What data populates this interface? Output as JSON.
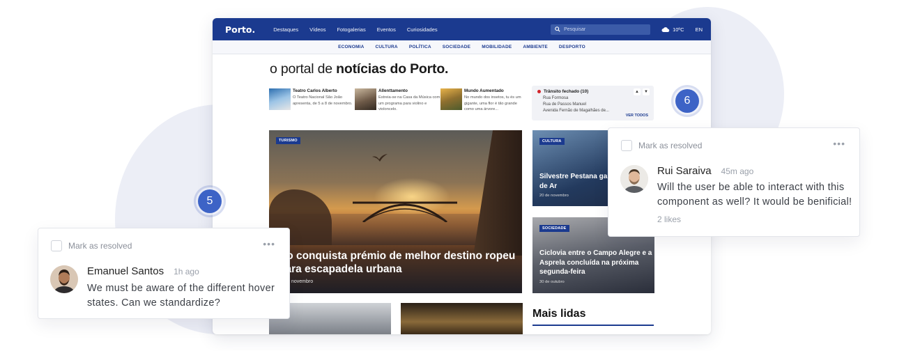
{
  "site": {
    "logo": "Porto.",
    "nav": [
      "Destaques",
      "Vídeos",
      "Fotogalerias",
      "Eventos",
      "Curiosidades"
    ],
    "search_placeholder": "Pesquisar",
    "temperature": "10ºC",
    "language": "EN",
    "categories": [
      "ECONOMIA",
      "CULTURA",
      "POLÍTICA",
      "SOCIEDADE",
      "MOBILIDADE",
      "AMBIENTE",
      "DESPORTO"
    ],
    "tagline_prefix": "o portal de ",
    "tagline_bold": "notícias do Porto."
  },
  "mini_articles": [
    {
      "title": "Teatro Carlos Alberto",
      "text": "O Teatro Nacional São João apresenta, de 5 a 8 de novembro."
    },
    {
      "title": "Allenttamento",
      "text": "Estreia-se na Casa da Música com um programa para violino e violoncelo."
    },
    {
      "title": "Mundo Aumentado",
      "text": "No mundo dos insetos, tu és um gigante, uma flor é tão grande como uma árvore..."
    }
  ],
  "traffic": {
    "title": "Trânsito fechado (10)",
    "items": [
      "Rua Formosa",
      "Rua de Passos Manuel",
      "Avenida Fernão de Magalhães de..."
    ],
    "see_all": "VER TODOS",
    "alert_color": "#d2232a"
  },
  "hero": {
    "badge": "TURISMO",
    "title": "rto conquista prémio de melhor destino ropeu para escapadela urbana",
    "date": "novembro"
  },
  "cards": [
    {
      "badge": "CULTURA",
      "title": "Silvestre Pestana ga com prémios de Ar",
      "date": "20 de novembro"
    },
    {
      "badge": "SOCIEDADE",
      "title": "Ciclovia entre o Campo Alegre e a Asprela concluída na próxima segunda-feira",
      "date": "30 de outubro"
    }
  ],
  "mais_lidas": "Mais lidas",
  "markers": {
    "left": "5",
    "right": "6"
  },
  "comments": {
    "left": {
      "resolve_label": "Mark as resolved",
      "author": "Emanuel Santos",
      "time": "1h ago",
      "text": "We must be aware of the different hover states. Can we standardize?"
    },
    "right": {
      "resolve_label": "Mark as resolved",
      "author": "Rui Saraiva",
      "time": "45m ago",
      "text": "Will the user be able to interact with this component as well? It would be benificial!",
      "likes": "2 likes"
    }
  },
  "colors": {
    "brand": "#1b3a8f",
    "marker": "#3d63c6"
  }
}
